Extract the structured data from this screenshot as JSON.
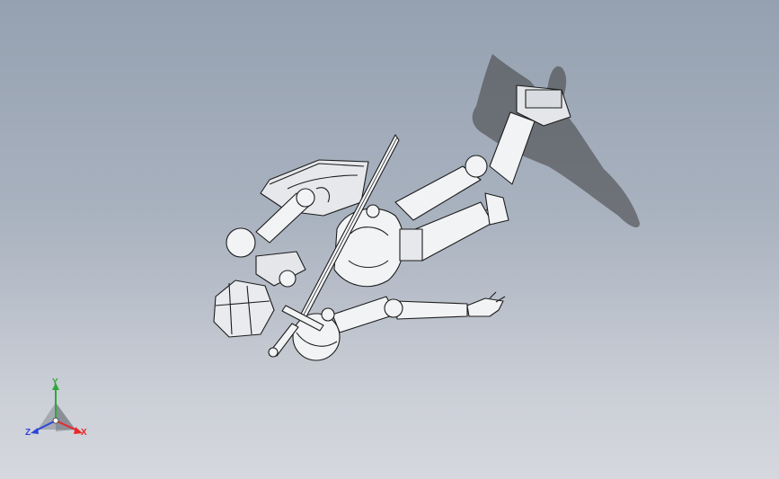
{
  "viewport": {
    "background_top": "#95a1b1",
    "background_bottom": "#d6d8de",
    "model_fill": "#f2f3f5",
    "model_edge": "#1c1c1c",
    "shadow_color": "#3e3e3e"
  },
  "triad": {
    "x_label": "X",
    "y_label": "Y",
    "z_label": "Z",
    "x_color": "#e8272b",
    "y_color": "#2ea83a",
    "z_color": "#2b46d8"
  }
}
